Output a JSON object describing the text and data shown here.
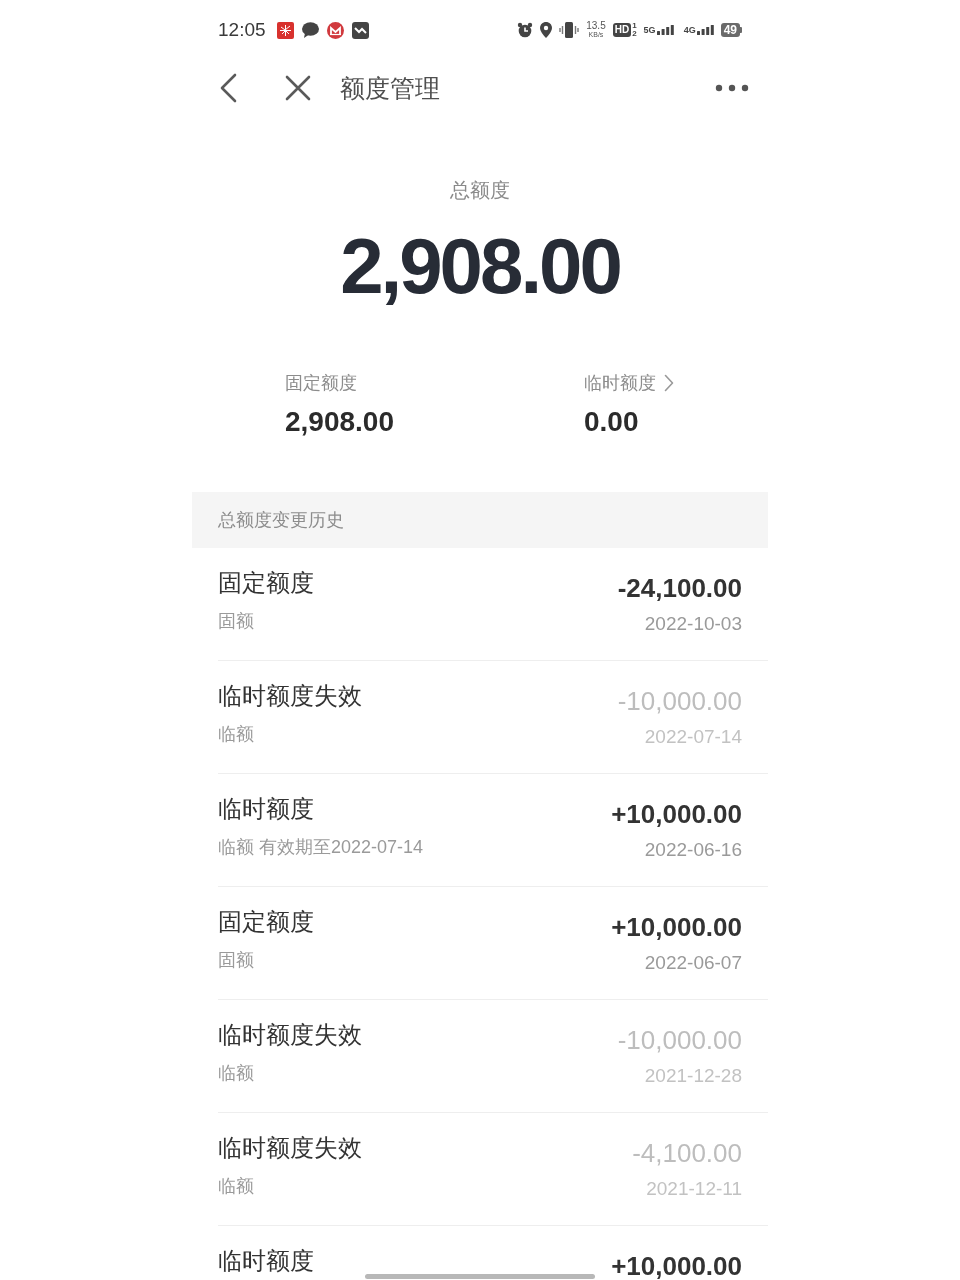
{
  "status_bar": {
    "time": "12:05",
    "net_speed": "13.5",
    "net_speed_unit": "KB/s",
    "hd_label": "HD",
    "sim_1": "1",
    "sim_2": "2",
    "network_1": "5G",
    "network_2": "4G",
    "battery": "49"
  },
  "nav": {
    "title": "额度管理"
  },
  "total": {
    "label": "总额度",
    "amount": "2,908.00"
  },
  "breakdown": [
    {
      "label": "固定额度",
      "amount": "2,908.00",
      "link": false
    },
    {
      "label": "临时额度",
      "amount": "0.00",
      "link": true
    }
  ],
  "history": {
    "title": "总额度变更历史",
    "rows": [
      {
        "title": "固定额度",
        "subtitle": "固额",
        "amount": "-24,100.00",
        "date": "2022-10-03",
        "expired": false
      },
      {
        "title": "临时额度失效",
        "subtitle": "临额",
        "amount": "-10,000.00",
        "date": "2022-07-14",
        "expired": true
      },
      {
        "title": "临时额度",
        "subtitle": "临额 有效期至2022-07-14",
        "amount": "+10,000.00",
        "date": "2022-06-16",
        "expired": false
      },
      {
        "title": "固定额度",
        "subtitle": "固额",
        "amount": "+10,000.00",
        "date": "2022-06-07",
        "expired": false
      },
      {
        "title": "临时额度失效",
        "subtitle": "临额",
        "amount": "-10,000.00",
        "date": "2021-12-28",
        "expired": true
      },
      {
        "title": "临时额度失效",
        "subtitle": "临额",
        "amount": "-4,100.00",
        "date": "2021-12-11",
        "expired": true
      },
      {
        "title": "临时额度",
        "amount": "+10,000.00",
        "expired": false
      }
    ]
  }
}
